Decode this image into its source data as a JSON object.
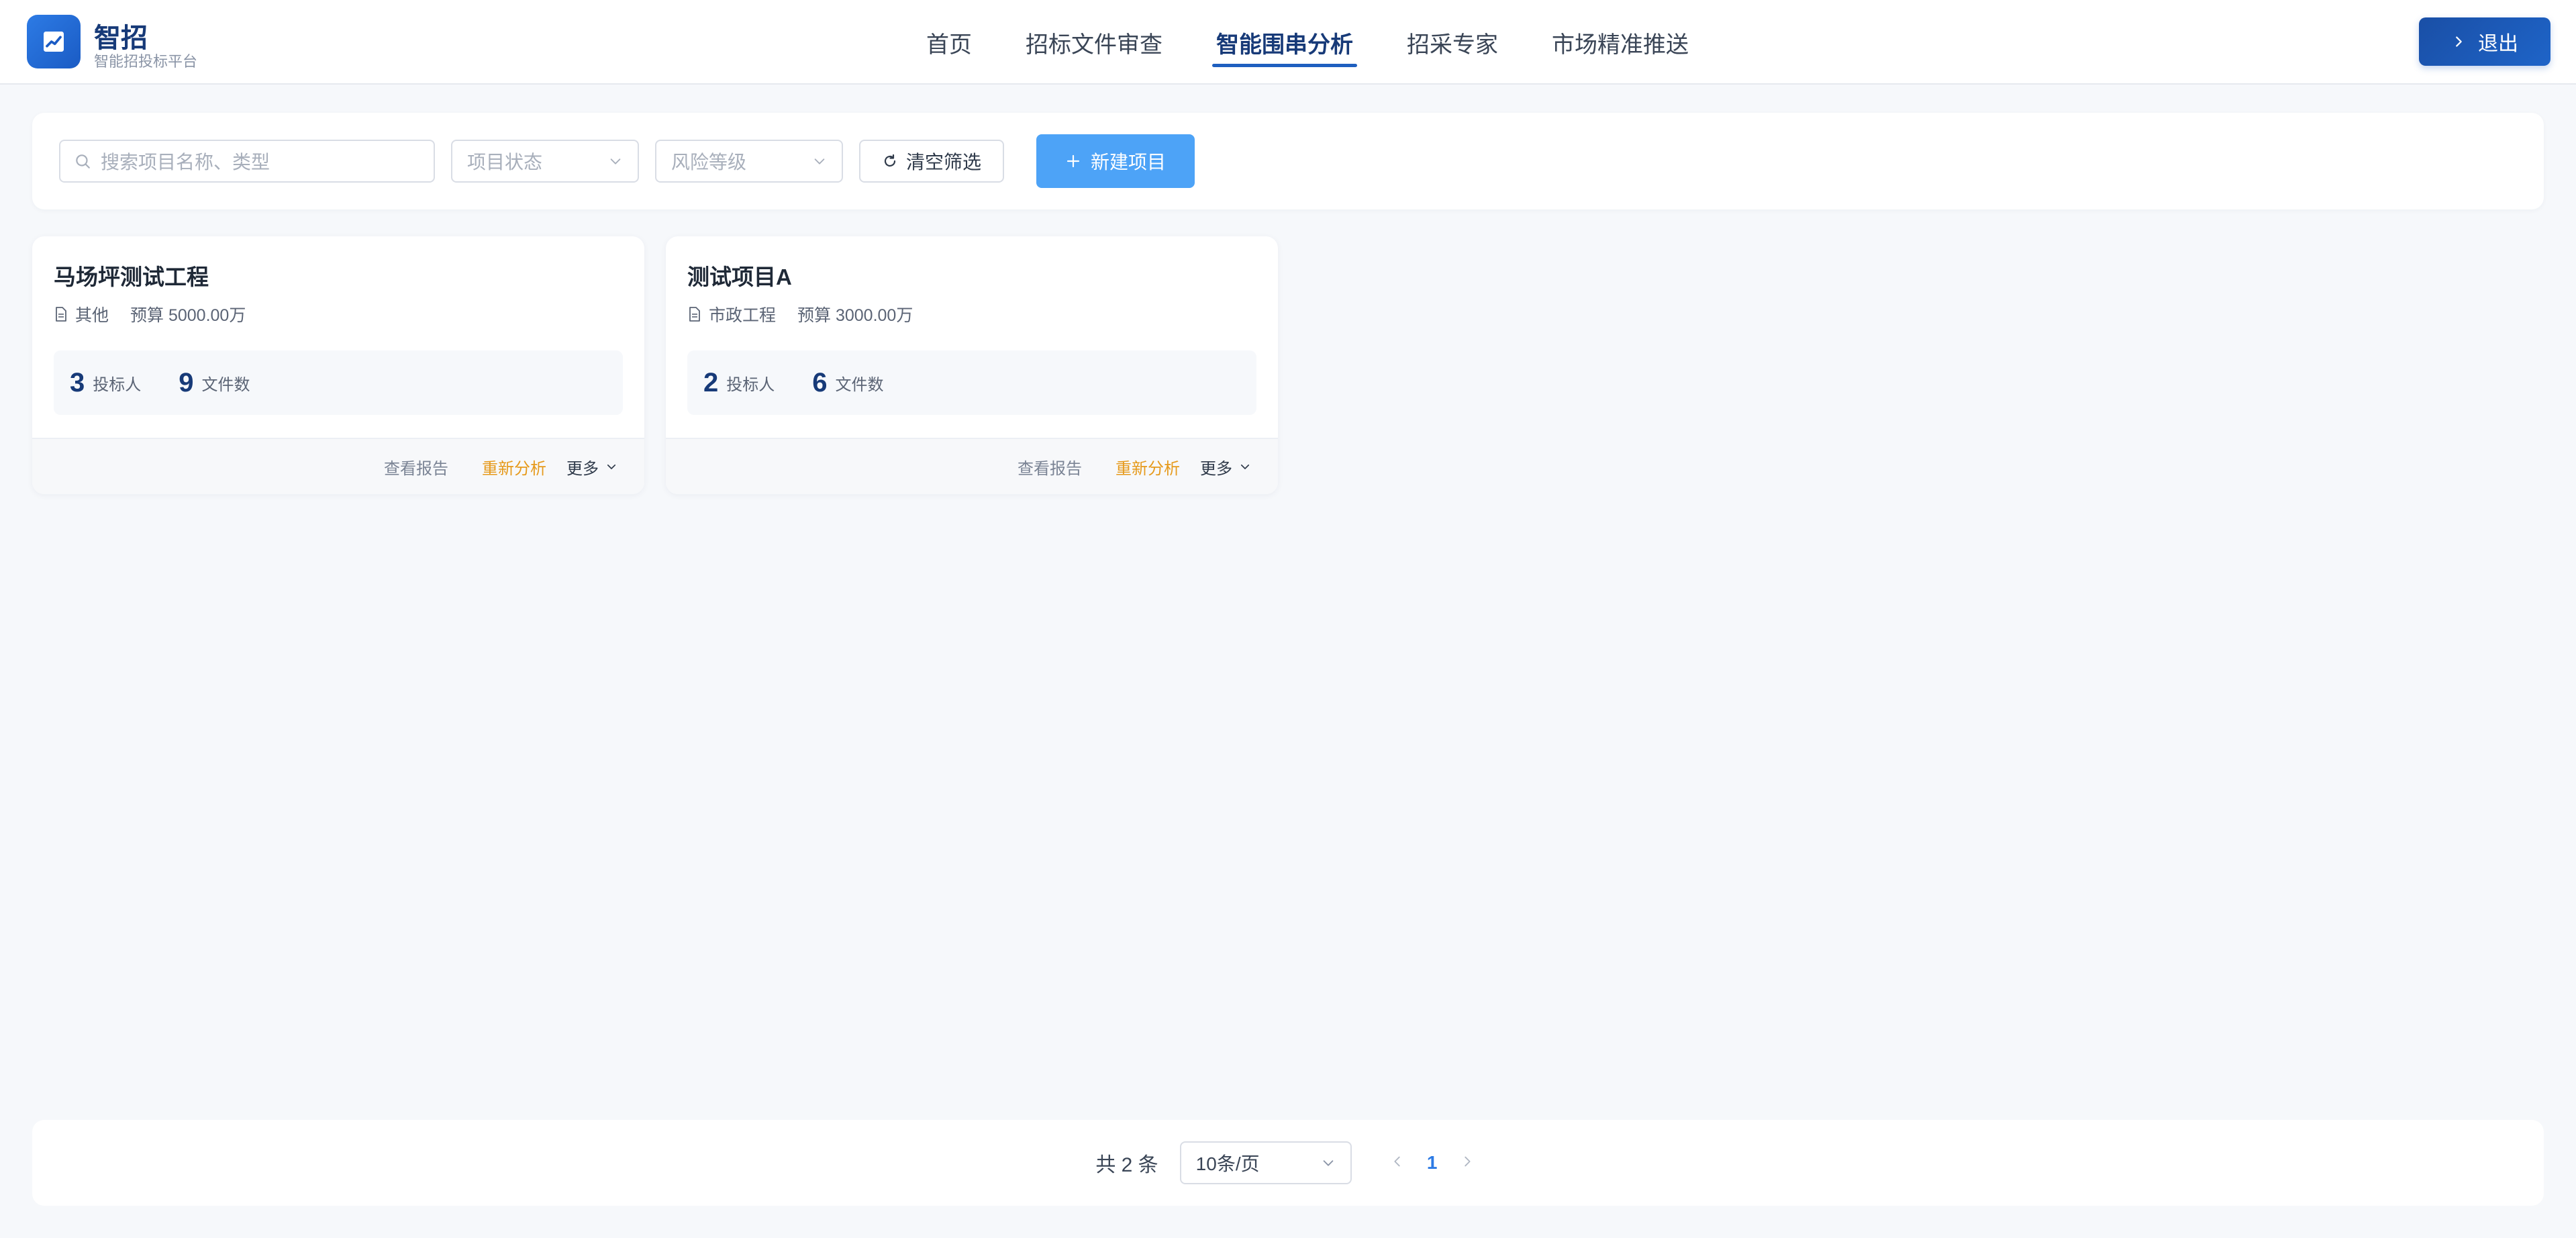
{
  "brand": {
    "title": "智招",
    "subtitle": "智能招投标平台",
    "icon": "trend-chart-icon"
  },
  "nav": {
    "items": [
      {
        "label": "首页",
        "active": false
      },
      {
        "label": "招标文件审查",
        "active": false
      },
      {
        "label": "智能围串分析",
        "active": true
      },
      {
        "label": "招采专家",
        "active": false
      },
      {
        "label": "市场精准推送",
        "active": false
      }
    ]
  },
  "logout": {
    "label": "退出",
    "icon": "chevron-right-icon"
  },
  "filters": {
    "search_placeholder": "搜索项目名称、类型",
    "status_placeholder": "项目状态",
    "risk_placeholder": "风险等级",
    "clear_label": "清空筛选",
    "new_label": "新建项目"
  },
  "projects": [
    {
      "name": "马场坪测试工程",
      "type": "其他",
      "budget": "预算 5000.00万",
      "bidders": "3",
      "bidders_label": "投标人",
      "files": "9",
      "files_label": "文件数",
      "report_label": "查看报告",
      "reanalyze_label": "重新分析",
      "more_label": "更多"
    },
    {
      "name": "测试项目A",
      "type": "市政工程",
      "budget": "预算 3000.00万",
      "bidders": "2",
      "bidders_label": "投标人",
      "files": "6",
      "files_label": "文件数",
      "report_label": "查看报告",
      "reanalyze_label": "重新分析",
      "more_label": "更多"
    }
  ],
  "pagination": {
    "total": "共 2 条",
    "page_size": "10条/页",
    "current_page": "1"
  },
  "colors": {
    "primary": "#173a78",
    "accent": "#4da3f7",
    "warning": "#e69a1c"
  }
}
